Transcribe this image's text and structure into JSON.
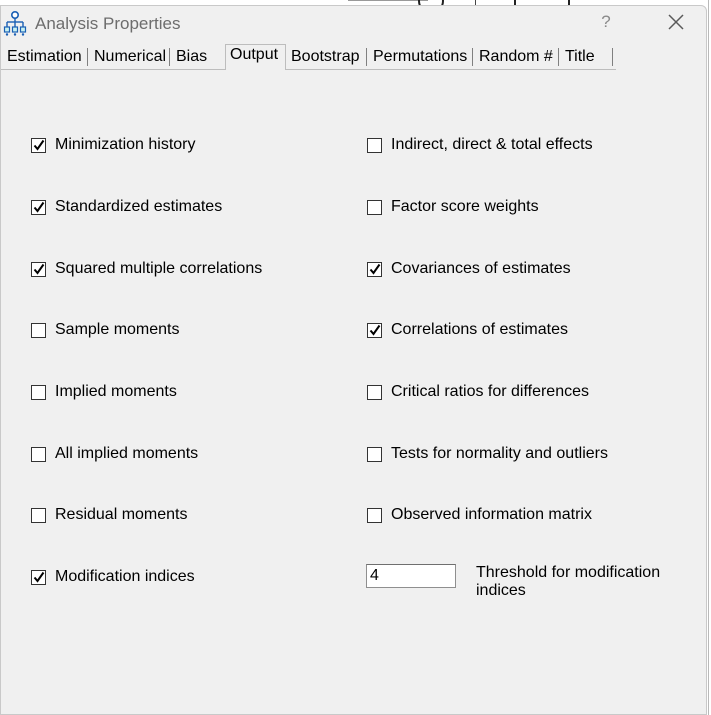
{
  "window": {
    "title": "Analysis Properties",
    "help": "?"
  },
  "tabs": [
    {
      "label": "Estimation",
      "active": false
    },
    {
      "label": "Numerical",
      "active": false
    },
    {
      "label": "Bias",
      "active": false
    },
    {
      "label": "Output",
      "active": true
    },
    {
      "label": "Bootstrap",
      "active": false
    },
    {
      "label": "Permutations",
      "active": false
    },
    {
      "label": "Random #",
      "active": false
    },
    {
      "label": "Title",
      "active": false
    }
  ],
  "left_options": [
    {
      "label": "Minimization history",
      "checked": true
    },
    {
      "label": "Standardized estimates",
      "checked": true
    },
    {
      "label": "Squared multiple correlations",
      "checked": true
    },
    {
      "label": "Sample moments",
      "checked": false
    },
    {
      "label": "Implied moments",
      "checked": false
    },
    {
      "label": "All implied moments",
      "checked": false
    },
    {
      "label": "Residual moments",
      "checked": false
    },
    {
      "label": "Modification indices",
      "checked": true
    }
  ],
  "right_options": [
    {
      "label": "Indirect, direct & total effects",
      "checked": false
    },
    {
      "label": "Factor score weights",
      "checked": false
    },
    {
      "label": "Covariances of estimates",
      "checked": true
    },
    {
      "label": "Correlations of estimates",
      "checked": true
    },
    {
      "label": "Critical ratios for differences",
      "checked": false
    },
    {
      "label": "Tests for normality and outliers",
      "checked": false
    },
    {
      "label": "Observed information matrix",
      "checked": false
    }
  ],
  "threshold": {
    "value": "4",
    "label": "Threshold for modification indices"
  }
}
